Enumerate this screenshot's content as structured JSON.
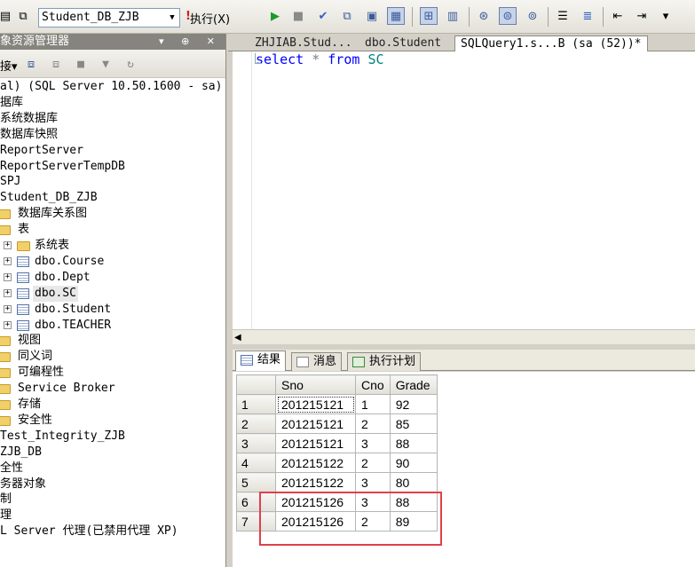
{
  "toolbar": {
    "database": "Student_DB_ZJB",
    "execute_label": "执行(X)"
  },
  "explorer": {
    "title": "象资源管理器",
    "connect_label": "接▾",
    "title_controls": "▾ ⊕ ✕",
    "tree": [
      {
        "text": "al) (SQL Server 10.50.1600 - sa)",
        "cjk": false
      },
      {
        "text": "据库",
        "cjk": true
      },
      {
        "text": "系统数据库",
        "cjk": true
      },
      {
        "text": "数据库快照",
        "cjk": true
      },
      {
        "text": "ReportServer",
        "cjk": false
      },
      {
        "text": "ReportServerTempDB",
        "cjk": false
      },
      {
        "text": "SPJ",
        "cjk": false
      },
      {
        "text": "Student_DB_ZJB",
        "cjk": false
      },
      {
        "text": "数据库关系图",
        "cjk": true
      },
      {
        "text": "表",
        "cjk": true
      },
      {
        "text": "系统表",
        "cjk": true
      },
      {
        "text": "dbo.Course",
        "cjk": false
      },
      {
        "text": "dbo.Dept",
        "cjk": false
      },
      {
        "text": "dbo.SC",
        "cjk": false
      },
      {
        "text": "dbo.Student",
        "cjk": false
      },
      {
        "text": "dbo.TEACHER",
        "cjk": false
      },
      {
        "text": "视图",
        "cjk": true
      },
      {
        "text": "同义词",
        "cjk": true
      },
      {
        "text": "可编程性",
        "cjk": true
      },
      {
        "text": "Service Broker",
        "cjk": false
      },
      {
        "text": "存储",
        "cjk": true
      },
      {
        "text": "安全性",
        "cjk": true
      },
      {
        "text": "Test_Integrity_ZJB",
        "cjk": false
      },
      {
        "text": "ZJB_DB",
        "cjk": false
      },
      {
        "text": "全性",
        "cjk": true
      },
      {
        "text": "务器对象",
        "cjk": true
      },
      {
        "text": "制",
        "cjk": true
      },
      {
        "text": "理",
        "cjk": true
      },
      {
        "text": "L Server 代理(已禁用代理 XP)",
        "cjk": false
      }
    ]
  },
  "tabs": [
    {
      "label": "ZHJIAB.Stud..."
    },
    {
      "label": "dbo.Student"
    },
    {
      "label": "SQLQuery1.s...B (sa (52))*"
    }
  ],
  "editor": {
    "kw_select": "select",
    "op_star": "*",
    "kw_from": "from",
    "table": "SC"
  },
  "results": {
    "tabs": [
      {
        "label": "结果"
      },
      {
        "label": "消息"
      },
      {
        "label": "执行计划"
      }
    ],
    "columns": [
      "Sno",
      "Cno",
      "Grade"
    ],
    "rows": [
      {
        "num": "1",
        "sno": "201215121",
        "cno": "1",
        "grade": "92"
      },
      {
        "num": "2",
        "sno": "201215121",
        "cno": "2",
        "grade": "85"
      },
      {
        "num": "3",
        "sno": "201215121",
        "cno": "3",
        "grade": "88"
      },
      {
        "num": "4",
        "sno": "201215122",
        "cno": "2",
        "grade": "90"
      },
      {
        "num": "5",
        "sno": "201215122",
        "cno": "3",
        "grade": "80"
      },
      {
        "num": "6",
        "sno": "201215126",
        "cno": "3",
        "grade": "88"
      },
      {
        "num": "7",
        "sno": "201215126",
        "cno": "2",
        "grade": "89"
      }
    ]
  },
  "colors": {
    "highlight_box": "#e0404a",
    "keyword": "#0000ff",
    "identifier": "#008080"
  }
}
